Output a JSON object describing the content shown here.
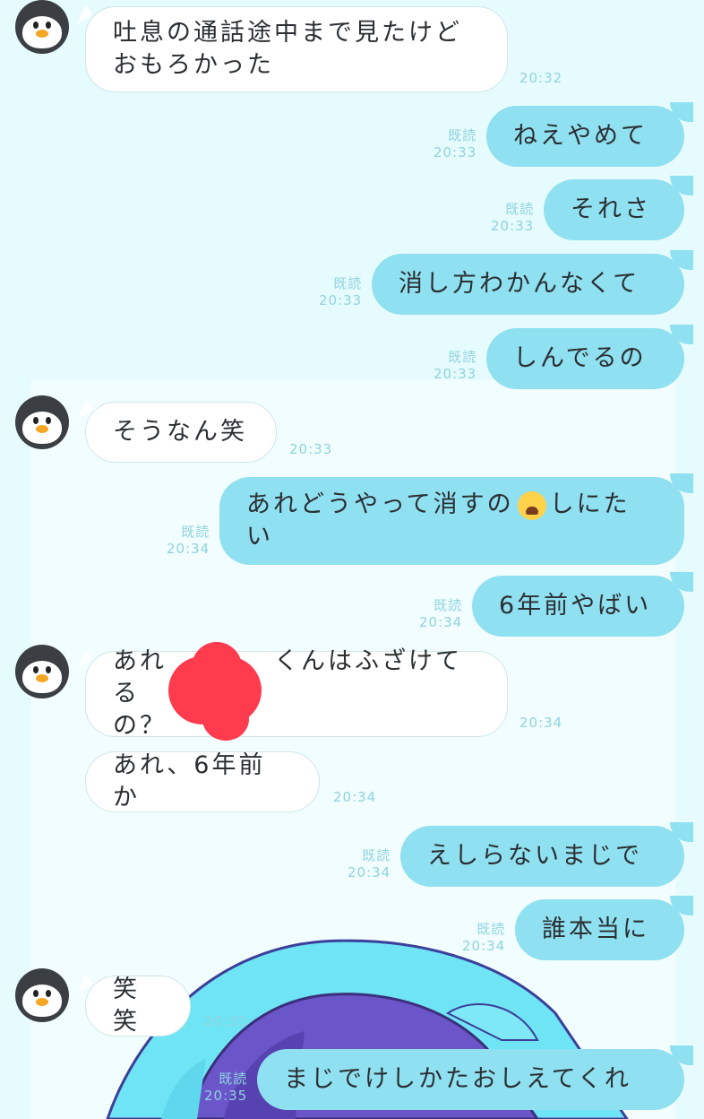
{
  "messages": [
    {
      "dir": "in",
      "avatar": true,
      "text": "吐息の通話途中まで見たけど\nおもろかった",
      "time": "20:32"
    },
    {
      "dir": "out",
      "read": "既読",
      "text": "ねえやめて",
      "time": "20:33"
    },
    {
      "dir": "out",
      "read": "既読",
      "text": "それさ",
      "time": "20:33"
    },
    {
      "dir": "out",
      "read": "既読",
      "text": "消し方わかんなくて",
      "time": "20:33"
    },
    {
      "dir": "out",
      "read": "既読",
      "text": "しんでるの",
      "time": "20:33"
    },
    {
      "dir": "in",
      "avatar": true,
      "text": "そうなん笑",
      "time": "20:33"
    },
    {
      "dir": "out",
      "read": "既読",
      "text_before": "あれどうやって消すの",
      "emoji": "loudly-crying-face",
      "text_after": "しにた\nい",
      "time": "20:34"
    },
    {
      "dir": "out",
      "read": "既読",
      "text": "6年前やばい",
      "time": "20:34"
    },
    {
      "dir": "in",
      "avatar": true,
      "text": "あれ　　　　くんはふざけてる\nの？",
      "time": "20:34",
      "redacted": true
    },
    {
      "dir": "in",
      "avatar": false,
      "text": "あれ、6年前か",
      "time": "20:34"
    },
    {
      "dir": "out",
      "read": "既読",
      "text": "えしらないまじで",
      "time": "20:34"
    },
    {
      "dir": "out",
      "read": "既読",
      "text": "誰本当に",
      "time": "20:34"
    },
    {
      "dir": "in",
      "avatar": true,
      "text": "笑笑",
      "time": "20:35"
    },
    {
      "dir": "out",
      "read": "既読",
      "text": "まじでけしかたおしえてくれ",
      "time": "20:35"
    }
  ],
  "colors": {
    "incoming": "#ffffff",
    "outgoing": "#8fe0f0",
    "meta": "#8fd3e0",
    "background": "#e6fbfd"
  }
}
